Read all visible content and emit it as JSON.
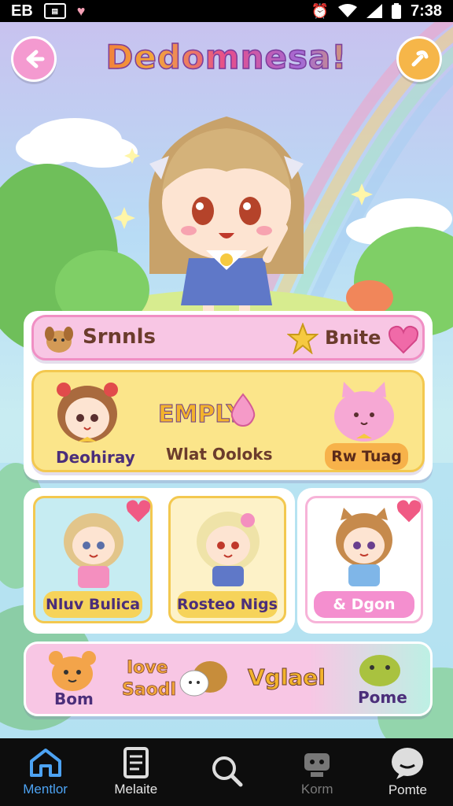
{
  "status_bar": {
    "left_text": "EB",
    "time": "7:38",
    "icons": [
      "news-icon",
      "heart-icon",
      "alarm-icon",
      "wifi-icon",
      "signal-icon",
      "battery-icon"
    ]
  },
  "header": {
    "title": "Dedomnesa!",
    "back_icon": "arrow-left-icon",
    "action_icon": "wrench-icon"
  },
  "top_bar": {
    "left_label": "Srnnls",
    "right_label": "Bnite"
  },
  "featured": {
    "left_caption": "Deohiray",
    "center_title": "EMPLY",
    "center_caption": "Wlat Ooloks",
    "right_caption": "Rw Tuag"
  },
  "characters": [
    {
      "caption": "Nluv Bulica"
    },
    {
      "caption": "Rosteo Nigs"
    },
    {
      "caption": "& Dgon"
    }
  ],
  "bottom_row": {
    "left_label": "Bom",
    "center_line1": "Iove",
    "center_line2": "Saodl",
    "right_label": "Vglael",
    "far_label": "Pome"
  },
  "nav": [
    {
      "label": "Mentlor",
      "icon": "home-icon"
    },
    {
      "label": "Melaite",
      "icon": "document-icon"
    },
    {
      "label": "",
      "icon": "search-icon"
    },
    {
      "label": "Korm",
      "icon": "robot-icon"
    },
    {
      "label": "Pomte",
      "icon": "chat-icon"
    }
  ],
  "colors": {
    "pink": "#f49ad0",
    "yellow": "#f6d35a",
    "mint": "#bdf0e4",
    "accent_blue": "#4da3f3"
  }
}
